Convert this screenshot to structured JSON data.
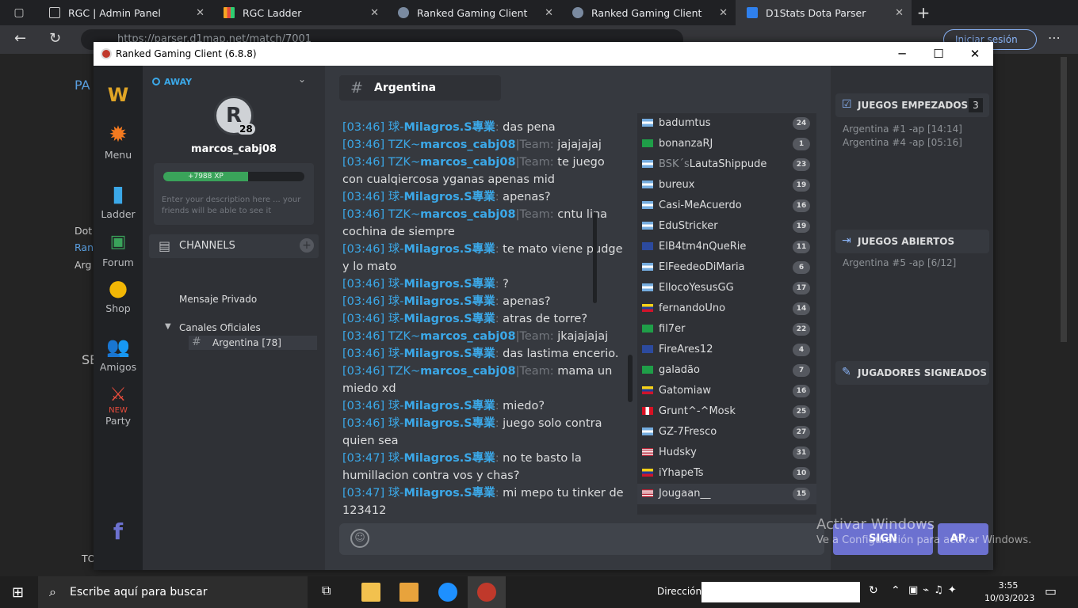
{
  "browser": {
    "tabs": [
      {
        "label": "RGC | Admin Panel",
        "icon": "page-icon"
      },
      {
        "label": "RGC Ladder",
        "icon": "chart-icon"
      },
      {
        "label": "Ranked Gaming Client",
        "icon": "rgc-icon"
      },
      {
        "label": "Ranked Gaming Client",
        "icon": "rgc-icon"
      },
      {
        "label": "D1Stats Dota Parser",
        "icon": "d1stats-icon"
      }
    ],
    "url": "https://parser.d1map.net/match/7001",
    "signin": "Iniciar sesión",
    "behind": {
      "pa": "PA",
      "dot": "Dot",
      "ran": "Ran",
      "arg": "Arg",
      "se": "SE",
      "to": "TO"
    }
  },
  "app": {
    "title": "Ranked Gaming Client (6.8.8)",
    "nav": [
      {
        "label": "",
        "icon": "warcraft-logo-icon"
      },
      {
        "label": "Menu",
        "icon": "gear-icon"
      },
      {
        "label": "Ladder",
        "icon": "bar-chart-icon"
      },
      {
        "label": "Forum",
        "icon": "terminal-icon"
      },
      {
        "label": "Shop",
        "icon": "coins-icon"
      },
      {
        "label": "Amigos",
        "icon": "friends-icon"
      },
      {
        "label": "NEW",
        "icon": "swords-icon"
      },
      {
        "label": "Party",
        "icon": ""
      },
      {
        "label": "",
        "icon": "facebook-icon"
      }
    ],
    "profile": {
      "status": "AWAY",
      "level": "28",
      "username": "marcos_cabj08",
      "xp": "+7988 XP",
      "xp_progress": 0.6,
      "description": "Enter your description here ... your friends will be able to see it"
    },
    "channels": {
      "header": "CHANNELS",
      "private": "Mensaje Privado",
      "official_group": "Canales Oficiales",
      "active": "Argentina [78]"
    },
    "chat": {
      "channel": "Argentina",
      "messages": [
        {
          "ts": "[03:46]",
          "clan": "球-",
          "nick": "Milagros.S專業",
          "sep": ":",
          "text": " das pena"
        },
        {
          "ts": "[03:46]",
          "clan": "TZK~",
          "nick": "marcos_cabj08",
          "team": "|Team:",
          "text": " jajajajaj"
        },
        {
          "ts": "[03:46]",
          "clan": "TZK~",
          "nick": "marcos_cabj08",
          "team": "|Team:",
          "text": " te juego con cualqiercosa yganas apenas mid"
        },
        {
          "ts": "[03:46]",
          "clan": "球-",
          "nick": "Milagros.S專業",
          "sep": ":",
          "text": " apenas?"
        },
        {
          "ts": "[03:46]",
          "clan": "TZK~",
          "nick": "marcos_cabj08",
          "team": "|Team:",
          "text": " cntu lina cochina de siempre"
        },
        {
          "ts": "[03:46]",
          "clan": "球-",
          "nick": "Milagros.S專業",
          "sep": ":",
          "text": " te mato viene pudge y lo mato"
        },
        {
          "ts": "[03:46]",
          "clan": "球-",
          "nick": "Milagros.S專業",
          "sep": ":",
          "text": " ?"
        },
        {
          "ts": "[03:46]",
          "clan": "球-",
          "nick": "Milagros.S專業",
          "sep": ":",
          "text": " apenas?"
        },
        {
          "ts": "[03:46]",
          "clan": "球-",
          "nick": "Milagros.S專業",
          "sep": ":",
          "text": " atras de torre?"
        },
        {
          "ts": "[03:46]",
          "clan": "TZK~",
          "nick": "marcos_cabj08",
          "team": "|Team:",
          "text": " jkajajajaj"
        },
        {
          "ts": "[03:46]",
          "clan": "球-",
          "nick": "Milagros.S專業",
          "sep": ":",
          "text": " das lastima encerio."
        },
        {
          "ts": "[03:46]",
          "clan": "TZK~",
          "nick": "marcos_cabj08",
          "team": "|Team:",
          "text": " mama un miedo xd"
        },
        {
          "ts": "[03:46]",
          "clan": "球-",
          "nick": "Milagros.S專業",
          "sep": ":",
          "text": " miedo?"
        },
        {
          "ts": "[03:46]",
          "clan": "球-",
          "nick": "Milagros.S專業",
          "sep": ":",
          "text": " juego solo contra quien sea"
        },
        {
          "ts": "[03:47]",
          "clan": "球-",
          "nick": "Milagros.S專業",
          "sep": ":",
          "text": " no te basto la humillacion contra vos y chas?"
        },
        {
          "ts": "[03:47]",
          "clan": "球-",
          "nick": "Milagros.S專業",
          "sep": ":",
          "text": " mi mepo tu tinker de 123412"
        }
      ]
    },
    "users": [
      {
        "name": "badumtus",
        "level": "24",
        "flag": "ar"
      },
      {
        "name": "bonanzaRJ",
        "level": "1",
        "flag": "br"
      },
      {
        "name": "BSK´sLautaShippude",
        "level": "23",
        "flag": "ar",
        "prefix": "BSK´s"
      },
      {
        "name": "bureux",
        "level": "19",
        "flag": "ar"
      },
      {
        "name": "Casi-MeAcuerdo",
        "level": "16",
        "flag": "ar"
      },
      {
        "name": "EduStricker",
        "level": "19",
        "flag": "ar"
      },
      {
        "name": "ElB4tm4nQueRie",
        "level": "11",
        "flag": "eu"
      },
      {
        "name": "ElFeedeoDiMaria",
        "level": "6",
        "flag": "ar"
      },
      {
        "name": "EllocoYesusGG",
        "level": "17",
        "flag": "ar"
      },
      {
        "name": "fernandoUno",
        "level": "14",
        "flag": "ve"
      },
      {
        "name": "fil7er",
        "level": "22",
        "flag": "br"
      },
      {
        "name": "FireAres12",
        "level": "4",
        "flag": "eu"
      },
      {
        "name": "galadão",
        "level": "7",
        "flag": "br"
      },
      {
        "name": "Gatomiaw",
        "level": "16",
        "flag": "ve"
      },
      {
        "name": "Grunt^-^Mosk",
        "level": "25",
        "flag": "pe"
      },
      {
        "name": "GZ-7Fresco",
        "level": "27",
        "flag": "ar"
      },
      {
        "name": "Hudsky",
        "level": "31",
        "flag": "us"
      },
      {
        "name": "iYhapeTs",
        "level": "10",
        "flag": "ve"
      },
      {
        "name": "Jougaan__",
        "level": "15",
        "flag": "us"
      }
    ],
    "games": {
      "started_label": "JUEGOS EMPEZADOS",
      "started_count": "3",
      "started": [
        "Argentina #1 -ap [14:14]",
        "Argentina #4 -ap [05:16]"
      ],
      "open_label": "JUEGOS ABIERTOS",
      "open": [
        "Argentina #5 -ap [6/12]"
      ],
      "signed_label": "JUGADORES SIGNEADOS"
    },
    "buttons": {
      "sign": "SIGN",
      "ap": "AP"
    }
  },
  "watermark": {
    "line1": "Activar Windows",
    "line2": "Ve a Configuración para activar Windows."
  },
  "taskbar": {
    "search": "Escribe aquí para buscar",
    "direction_label": "Dirección",
    "time": "3:55",
    "date": "10/03/2023"
  },
  "colors": {
    "accent": "#3ba8e8",
    "button": "#6c71d0",
    "xp": "#3aa35a"
  }
}
